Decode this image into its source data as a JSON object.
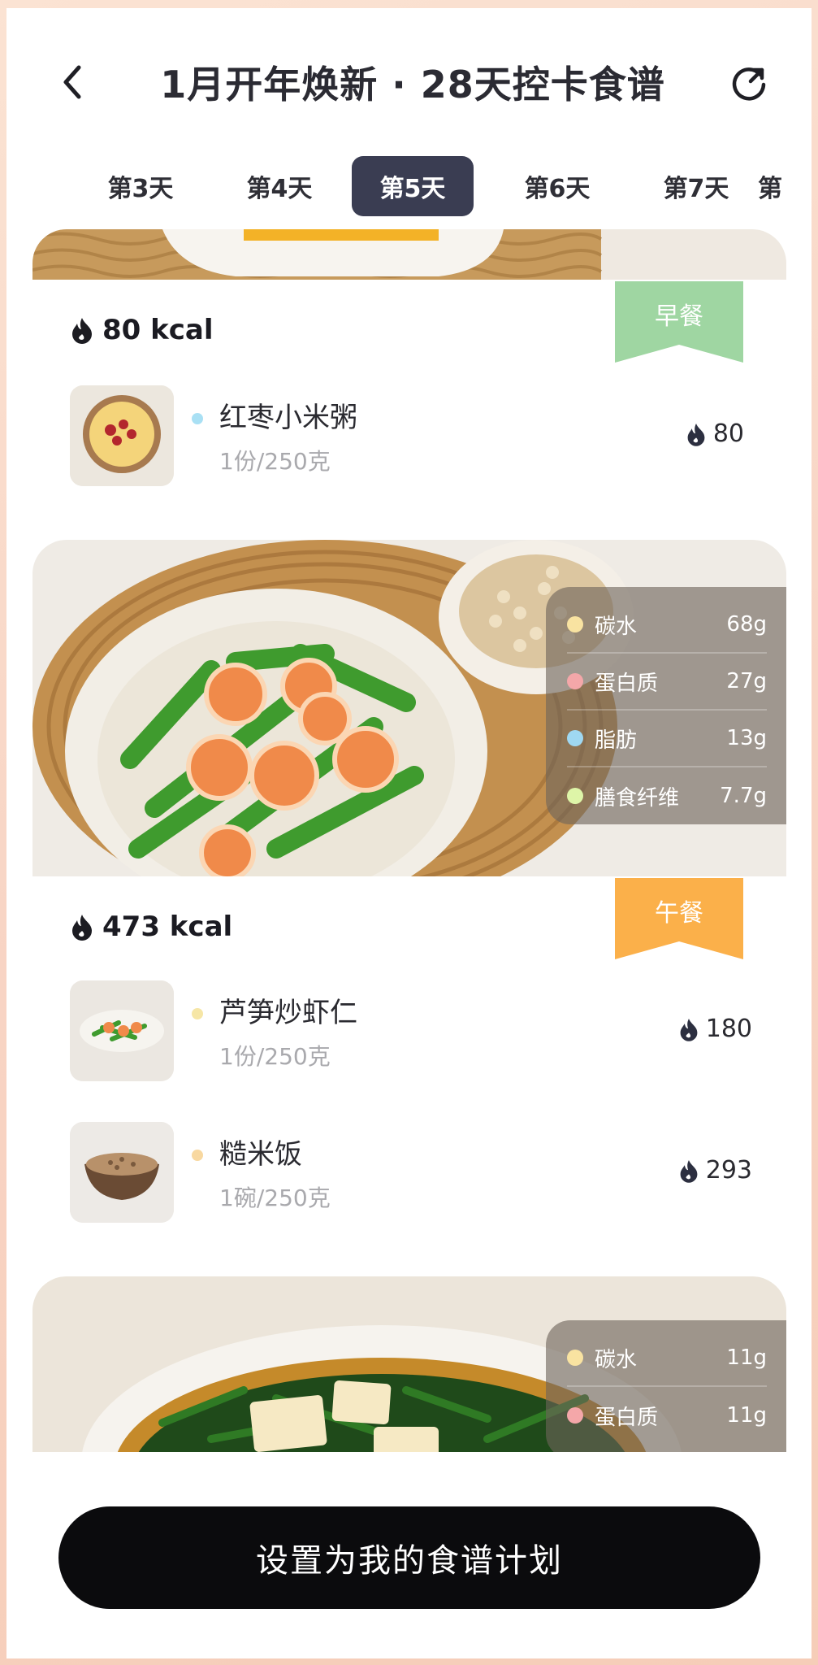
{
  "header": {
    "title": "1月开年焕新 · 28天控卡食谱"
  },
  "tabs": [
    "第3天",
    "第4天",
    "第5天",
    "第6天",
    "第7天",
    "第"
  ],
  "active_tab": "第5天",
  "meals": [
    {
      "tag": "早餐",
      "tag_color": "#9fd6a2",
      "kcal": "80 kcal",
      "foods": [
        {
          "name": "红枣小米粥",
          "portion": "1份/250克",
          "calories": "80",
          "dot_color": "#a9e0f4"
        }
      ]
    },
    {
      "tag": "午餐",
      "tag_color": "#fbb04a",
      "kcal": "473 kcal",
      "nutrients": [
        {
          "name": "碳水",
          "value": "68g",
          "color": "#f9e3a1"
        },
        {
          "name": "蛋白质",
          "value": "27g",
          "color": "#f4a7a9"
        },
        {
          "name": "脂肪",
          "value": "13g",
          "color": "#9fd8f2"
        },
        {
          "name": "膳食纤维",
          "value": "7.7g",
          "color": "#def5a8"
        }
      ],
      "foods": [
        {
          "name": "芦笋炒虾仁",
          "portion": "1份/250克",
          "calories": "180",
          "dot_color": "#f6e6a6"
        },
        {
          "name": "糙米饭",
          "portion": "1碗/250克",
          "calories": "293",
          "dot_color": "#f8d8a0"
        }
      ]
    },
    {
      "nutrients": [
        {
          "name": "碳水",
          "value": "11g",
          "color": "#f9e3a1"
        },
        {
          "name": "蛋白质",
          "value": "11g",
          "color": "#f4a7a9"
        }
      ]
    }
  ],
  "bottom_button": "设置为我的食谱计划",
  "icons": {
    "back": "chevron-left-icon",
    "share": "share-refresh-icon",
    "flame": "flame-icon"
  }
}
